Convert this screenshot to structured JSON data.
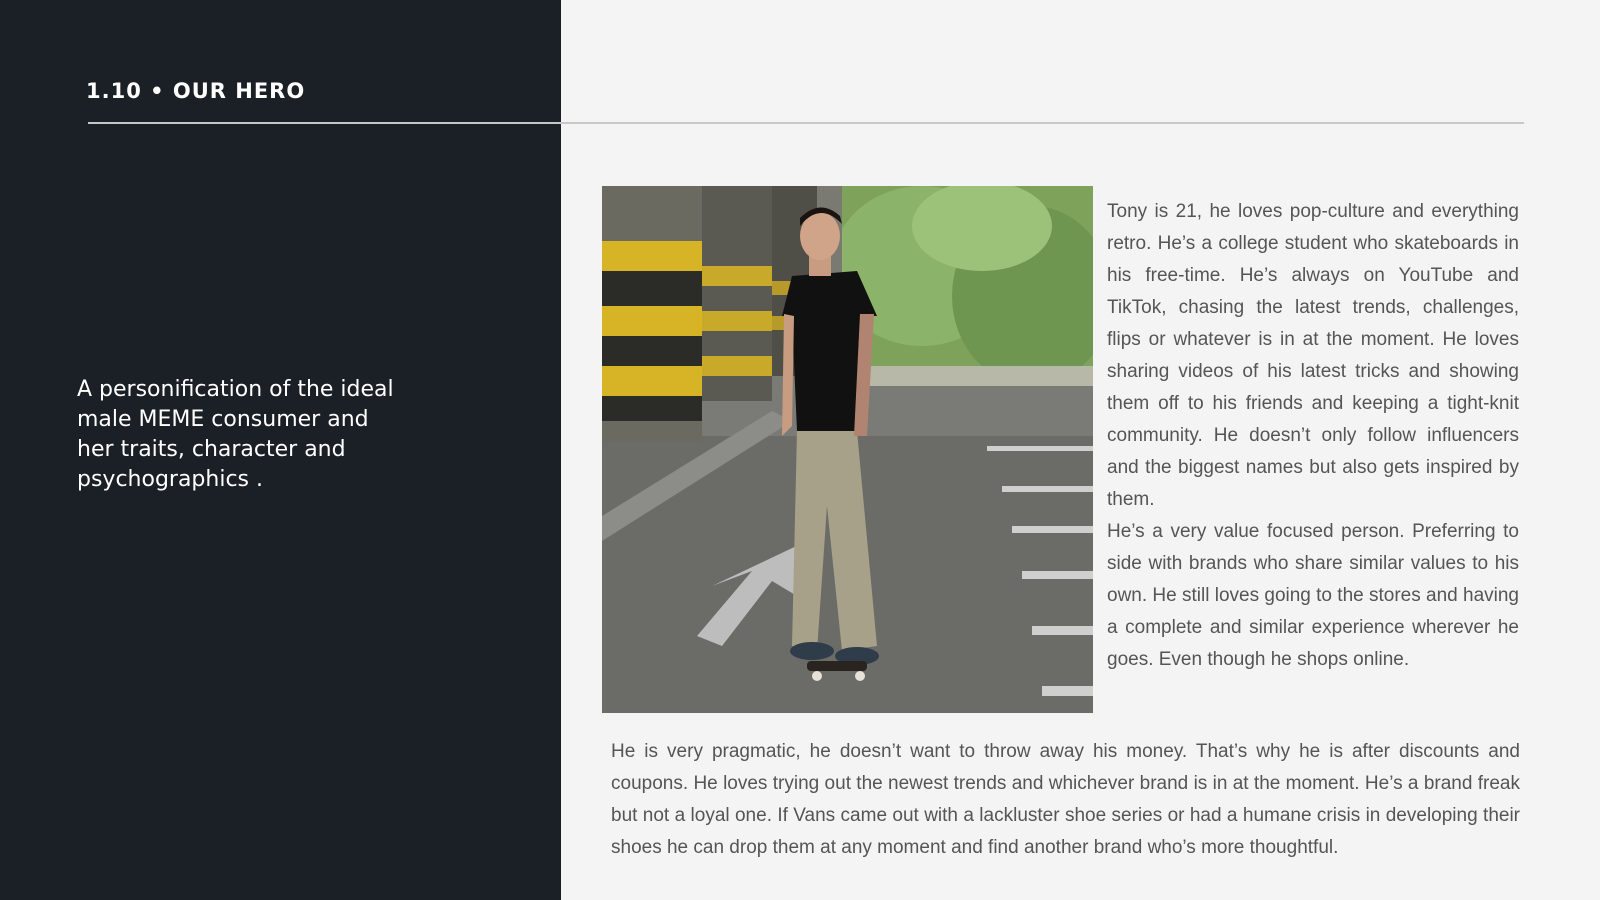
{
  "slide": {
    "section_title": "1.10 • OUR HERO",
    "tagline": "A personification of the ideal male MEME consumer and her traits, character and psychographics ."
  },
  "image": {
    "subject": "young man in black t-shirt and khaki pants standing on a skateboard in a parking garage",
    "icon": "hero-photo"
  },
  "body": {
    "paragraph_1": "Tony is 21, he loves pop-culture and everything retro.  He’s a college student who skateboards in his free-time. He’s always on YouTube and TikTok, chasing the latest trends, challenges, flips or whatever is in at the moment. He loves sharing videos of his latest tricks and showing them off to his friends and keeping a tight-knit community. He doesn’t only follow influencers and the biggest names but also gets inspired by them.",
    "paragraph_2": "He’s a very value focused person. Preferring to side with brands who share similar values to his own. He still loves going to the stores and having a complete and similar experience wherever he goes. Even though he shops online.",
    "paragraph_3": "He is very pragmatic, he doesn’t want to throw away his money. That’s why he is after discounts and coupons. He loves trying out the newest trends and whichever brand is in at the moment. He’s a brand freak but not a loyal one. If Vans came out with a lackluster shoe series or had a humane crisis in developing their shoes he can drop them at any moment and find another brand who’s more thoughtful."
  },
  "colors": {
    "left_panel": "#1b1f26",
    "background": "#f4f4f4",
    "text": "#555555",
    "rule": "#c8c8c8"
  }
}
